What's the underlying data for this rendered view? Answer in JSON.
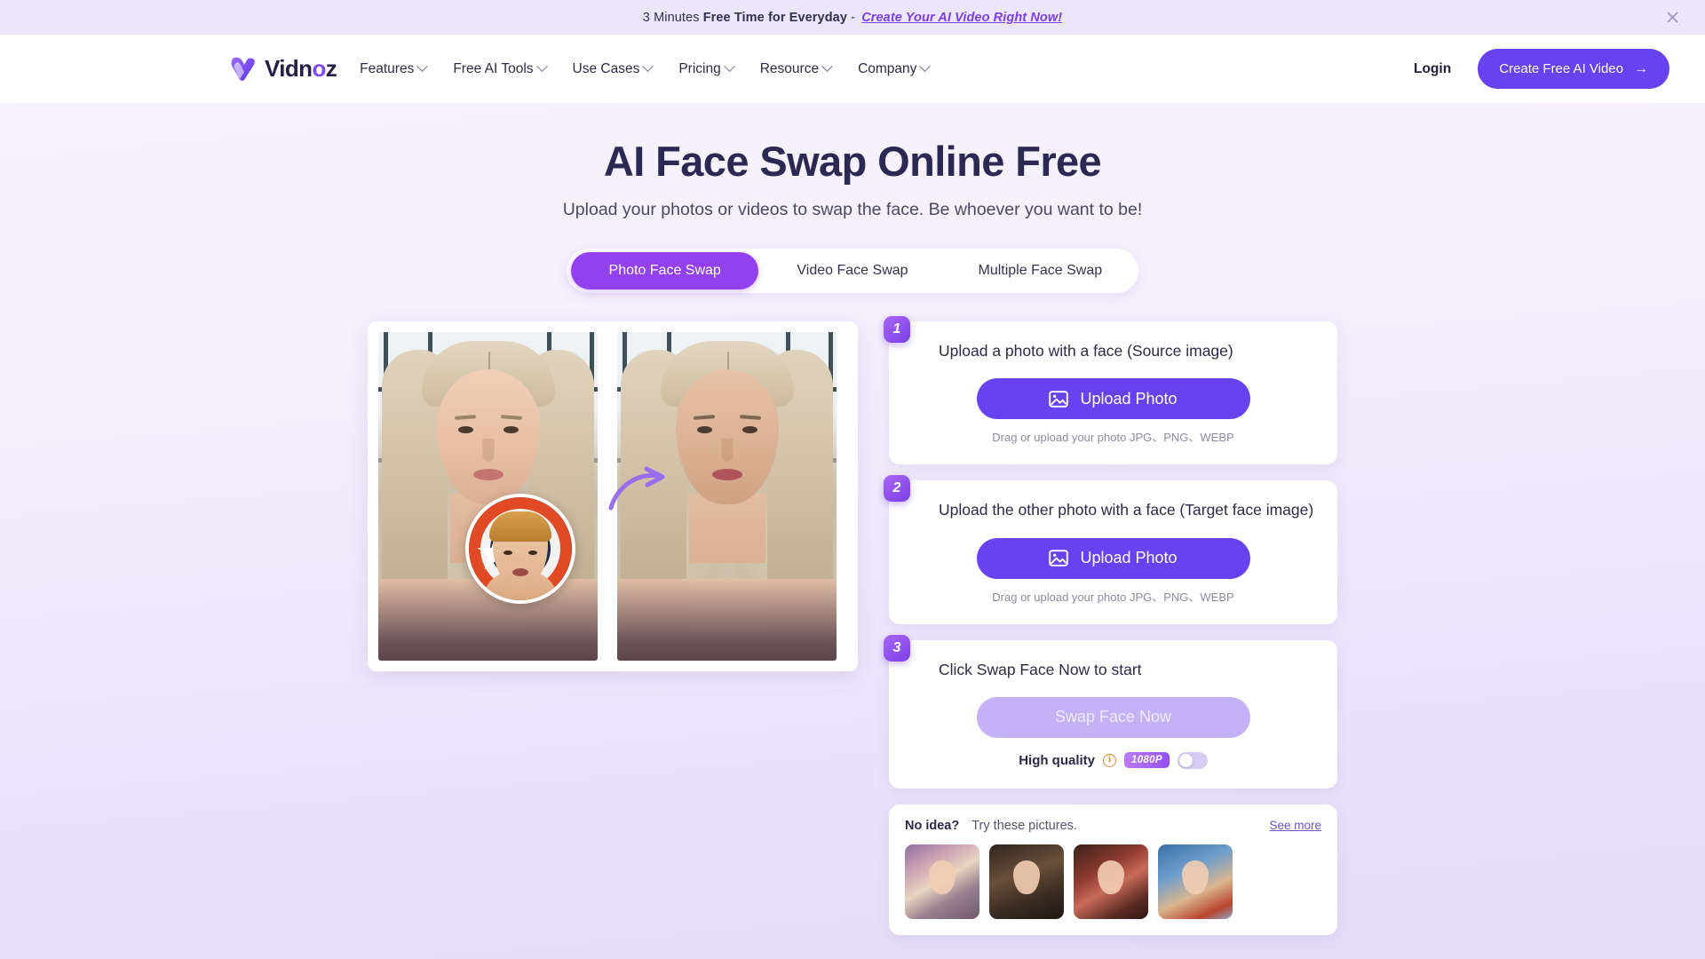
{
  "promo": {
    "text_prefix": "3 Minutes ",
    "text_bold": "Free Time for Everyday",
    "text_dash": " - ",
    "link": "Create Your AI Video Right Now!",
    "close_icon": "close-icon"
  },
  "header": {
    "logo_text_a": "Vidn",
    "logo_text_o": "o",
    "logo_text_b": "z",
    "nav": [
      {
        "label": "Features"
      },
      {
        "label": "Free AI Tools"
      },
      {
        "label": "Use Cases"
      },
      {
        "label": "Pricing"
      },
      {
        "label": "Resource"
      },
      {
        "label": "Company"
      }
    ],
    "login": "Login",
    "cta": "Create Free AI Video",
    "cta_arrow": "→"
  },
  "hero": {
    "title": "AI Face Swap Online Free",
    "subtitle": "Upload your photos or videos to swap the face. Be whoever you want to be!"
  },
  "tabs": [
    {
      "label": "Photo Face Swap",
      "active": true
    },
    {
      "label": "Video Face Swap",
      "active": false
    },
    {
      "label": "Multiple Face Swap",
      "active": false
    }
  ],
  "steps": [
    {
      "number": "1",
      "title": "Upload a photo with a face (Source image)",
      "button": "Upload Photo",
      "hint": "Drag or upload your photo JPG、PNG、WEBP"
    },
    {
      "number": "2",
      "title": "Upload the other photo with a face (Target face image)",
      "button": "Upload Photo",
      "hint": "Drag or upload your photo JPG、PNG、WEBP"
    },
    {
      "number": "3",
      "title": "Click Swap Face Now to start",
      "button": "Swap Face Now",
      "quality_label": "High quality",
      "quality_badge": "1080P",
      "toggle_state": "off"
    }
  ],
  "ideas": {
    "title": "No idea?",
    "subtitle": "Try these pictures.",
    "see_more": "See more",
    "thumbnails": [
      {
        "alt": "fantasy-portrait-thumbnail"
      },
      {
        "alt": "warrior-woman-thumbnail"
      },
      {
        "alt": "christmas-santa-hat-thumbnail"
      },
      {
        "alt": "school-uniform-woman-thumbnail"
      }
    ]
  },
  "preview": {
    "left_alt": "original-portrait",
    "right_alt": "face-swapped-portrait",
    "inset_alt": "source-face-circle",
    "arrow_alt": "swap-arrow-icon"
  },
  "colors": {
    "accent_purple": "#6742ef",
    "tab_active": "#9340ef",
    "heading": "#2c2854",
    "banner_bg": "#ece6fb"
  }
}
